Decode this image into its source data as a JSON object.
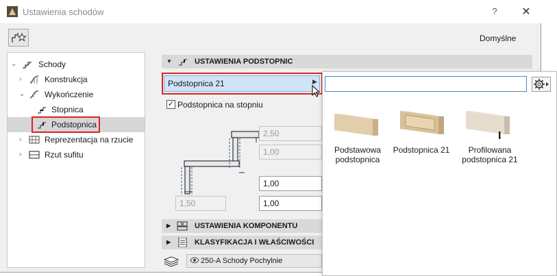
{
  "window": {
    "title": "Ustawienia schodów",
    "help_label": "?",
    "close_label": "✕",
    "default_label": "Domyślne"
  },
  "tree": {
    "items": [
      {
        "label": "Schody",
        "level": 0,
        "expanded": true
      },
      {
        "label": "Konstrukcja",
        "level": 1,
        "expanded": false
      },
      {
        "label": "Wykończenie",
        "level": 1,
        "expanded": true
      },
      {
        "label": "Stopnica",
        "level": 2
      },
      {
        "label": "Podstopnica",
        "level": 2,
        "selected": true
      },
      {
        "label": "Reprezentacja na rzucie",
        "level": 1,
        "expanded": false
      },
      {
        "label": "Rzut sufitu",
        "level": 1,
        "expanded": false
      }
    ]
  },
  "main": {
    "section_riser": "USTAWIENIA PODSTOPNIC",
    "riser_selector": "Podstopnica 21",
    "checkbox": {
      "label": "Podstopnica na stopniu",
      "checked": true
    },
    "fields": {
      "f1": "2,50",
      "f2": "1,00",
      "f3": "1,00",
      "f4": "1,00",
      "f5": "1,50"
    },
    "section_component": "USTAWIENIA KOMPONENTU PODST",
    "section_classif": "KLASYFIKACJA I WŁAŚCIWOŚCI",
    "classification_value": "250-A Schody Pochylnie"
  },
  "popup": {
    "search_value": "",
    "items": [
      {
        "label": "Podstawowa podstopnica"
      },
      {
        "label": "Podstopnica 21"
      },
      {
        "label": "Profilowana podstopnica 21"
      }
    ]
  },
  "colors": {
    "highlight_red": "#e02020",
    "selection_blue": "#cfe4f7",
    "wood": "#dcc9a6"
  }
}
